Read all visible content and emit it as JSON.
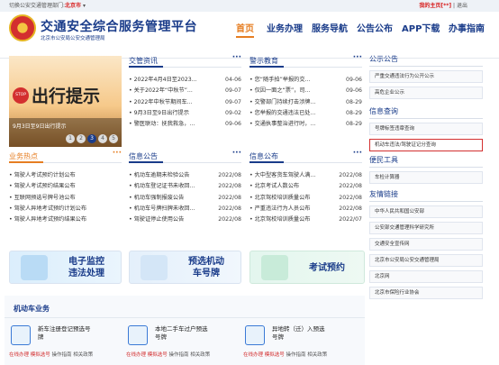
{
  "topbar": {
    "prefix": "切换公安交通管理部门:",
    "city": "北京市",
    "arrow": "▾",
    "user": "我的主页[**]",
    "logout": "退出"
  },
  "header": {
    "title": "交通安全综合服务管理平台",
    "subtitle": "北京市公安局公安交通管理局"
  },
  "nav": [
    {
      "label": "首页",
      "active": true
    },
    {
      "label": "业务办理"
    },
    {
      "label": "服务导航"
    },
    {
      "label": "公告公布"
    },
    {
      "label": "APP下载"
    },
    {
      "label": "办事指南"
    }
  ],
  "banner": {
    "text": "出行提示",
    "stop": "STOP",
    "caption": "9月3日至9日出行提示",
    "pages": [
      "1",
      "2",
      "3",
      "4",
      "5"
    ],
    "current_page": 3
  },
  "more": "···",
  "news_col1": {
    "title": "交管资讯",
    "items": [
      {
        "text": "• 2022年4月4日至2023...",
        "date": "04-06"
      },
      {
        "text": "• 关于2022年“中秋节”...",
        "date": "09-07"
      },
      {
        "text": "• 2022年中秋节期间车...",
        "date": "09-07"
      },
      {
        "text": "• 9月3日至9日出行提示",
        "date": "09-02"
      },
      {
        "text": "• 警医联动：抚我救急，...",
        "date": "09-06"
      }
    ]
  },
  "news_col2": {
    "title": "警示教育",
    "items": [
      {
        "text": "• 您“随手拍”举报的交...",
        "date": "09-06"
      },
      {
        "text": "• 仅因一面之“票”，司...",
        "date": "09-06"
      },
      {
        "text": "• 交警部门持续打击涉牌...",
        "date": "08-29"
      },
      {
        "text": "• 您举报的交通违法已处...",
        "date": "08-29"
      },
      {
        "text": "• 交通执事整治进行时，...",
        "date": "08-29"
      }
    ]
  },
  "hot": {
    "title": "业务热点",
    "items": [
      {
        "text": "• 驾驶人考试预约计划公布"
      },
      {
        "text": "• 驾驶人考试预约结果公布"
      },
      {
        "text": "• 互联网预选号牌号池公布"
      },
      {
        "text": "• 驾驶人异地考试预约计划公布"
      },
      {
        "text": "• 驾驶人异地考试预约结果公布"
      }
    ]
  },
  "info_notice": {
    "title": "信息公告",
    "items": [
      {
        "text": "• 机动车逾期未检验公告",
        "date": "2022/08"
      },
      {
        "text": "• 机动车登记证书未收回...",
        "date": "2022/08"
      },
      {
        "text": "• 机动车强制报废公告",
        "date": "2022/08"
      },
      {
        "text": "• 机动车号牌扫牌未收回...",
        "date": "2022/08"
      },
      {
        "text": "• 驾驶证停止使用公告",
        "date": "2022/08"
      }
    ]
  },
  "info_publish": {
    "title": "信息公布",
    "items": [
      {
        "text": "• 大中型客货车驾驶人满...",
        "date": "2022/08"
      },
      {
        "text": "• 北京考试人数公布",
        "date": "2022/08"
      },
      {
        "text": "• 北京驾校培训质量公布",
        "date": "2022/08"
      },
      {
        "text": "• 严重违法行为人员公布",
        "date": "2022/08"
      },
      {
        "text": "• 北京驾校培训质量公布",
        "date": "2022/07"
      }
    ]
  },
  "services": [
    {
      "label": "电子监控\n违法处理"
    },
    {
      "label": "预选机动\n车号牌"
    },
    {
      "label": "考试预约"
    }
  ],
  "vehicle": {
    "title": "机动车业务",
    "items": [
      {
        "name": "新车注册登记预选号\n牌",
        "links": [
          "在线办理",
          "模拟选号",
          "操作指南",
          "相关政策"
        ]
      },
      {
        "name": "本地二手车过户预选\n号牌",
        "links": [
          "在线办理",
          "模拟选号",
          "操作指南",
          "相关政策"
        ]
      },
      {
        "name": "异地转（迁）入预选\n号牌",
        "links": [
          "在线办理",
          "模拟选号",
          "操作指南",
          "相关政策"
        ]
      }
    ]
  },
  "sidebar": {
    "gonggao": {
      "title": "公示公告",
      "items": [
        "严重交通违法行为公开公示",
        "高危企业公示"
      ]
    },
    "query": {
      "title": "信息查询",
      "items": [
        "号牌标签违章查询",
        "机动车违法/驾驶证记分查询"
      ],
      "highlight": 1
    },
    "tools": {
      "title": "便民工具",
      "items": [
        "车检计算器"
      ]
    },
    "links": {
      "title": "友情链接",
      "items": [
        "中华人民共和国公安部",
        "公安部交通管理科学研究所",
        "交通安全宣传网",
        "北京市公安局公安交通管理局",
        "北京网",
        "北京市保险行业协会"
      ]
    }
  }
}
